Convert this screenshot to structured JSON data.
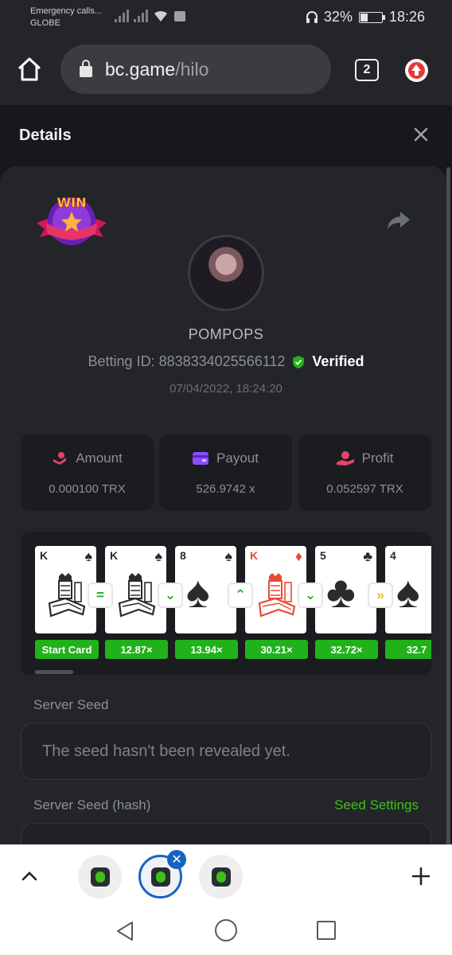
{
  "status_bar": {
    "carrier_line1": "Emergency calls...",
    "carrier_line2": "GLOBE",
    "battery_percent": "32%",
    "battery_level": 0.32,
    "time": "18:26"
  },
  "browser": {
    "url_host": "bc.game",
    "url_path": "/hilo",
    "tab_count": "2"
  },
  "details": {
    "title": "Details",
    "username": "POMPOPS",
    "betting_id": "Betting ID: 8838334025566112",
    "verified_label": "Verified",
    "date": "07/04/2022, 18:24:20",
    "badge_text": "WIN"
  },
  "stats": [
    {
      "label": "Amount",
      "value": "0.000100 TRX",
      "icon": "amount-icon",
      "color": "#e6436b"
    },
    {
      "label": "Payout",
      "value": "526.9742 x",
      "icon": "wallet-icon",
      "color": "#8b4dff"
    },
    {
      "label": "Profit",
      "value": "0.052597 TRX",
      "icon": "profit-icon",
      "color": "#e6436b"
    }
  ],
  "cards": [
    {
      "rank": "K",
      "suit": "♠",
      "face": true,
      "red": false,
      "multiplier": "Start Card"
    },
    {
      "rank": "K",
      "suit": "♠",
      "face": true,
      "red": false,
      "multiplier": "12.87×"
    },
    {
      "rank": "8",
      "suit": "♠",
      "face": false,
      "red": false,
      "multiplier": "13.94×"
    },
    {
      "rank": "K",
      "suit": "♦",
      "face": true,
      "red": true,
      "multiplier": "30.21×"
    },
    {
      "rank": "5",
      "suit": "♣",
      "face": false,
      "red": false,
      "multiplier": "32.72×"
    },
    {
      "rank": "4",
      "suit": "♠",
      "face": false,
      "red": false,
      "multiplier": "32.7"
    }
  ],
  "guesses": [
    {
      "symbol": "=",
      "color": "#20b21a",
      "icon": "equal-icon"
    },
    {
      "symbol": "⌄",
      "color": "#20b21a",
      "icon": "lower-icon"
    },
    {
      "symbol": "⌃",
      "color": "#20b21a",
      "icon": "higher-icon"
    },
    {
      "symbol": "⌄",
      "color": "#20b21a",
      "icon": "lower-icon"
    },
    {
      "symbol": "»",
      "color": "#e6c31a",
      "icon": "skip-icon"
    }
  ],
  "seeds": {
    "server_seed_label": "Server Seed",
    "server_seed_value": "The seed hasn't been revealed yet.",
    "hash_label": "Server Seed (hash)",
    "seed_settings": "Seed Settings"
  },
  "colors": {
    "accent_green": "#3bc117",
    "multiplier_green": "#20b21a",
    "panel": "#232528",
    "background": "#17181b"
  }
}
